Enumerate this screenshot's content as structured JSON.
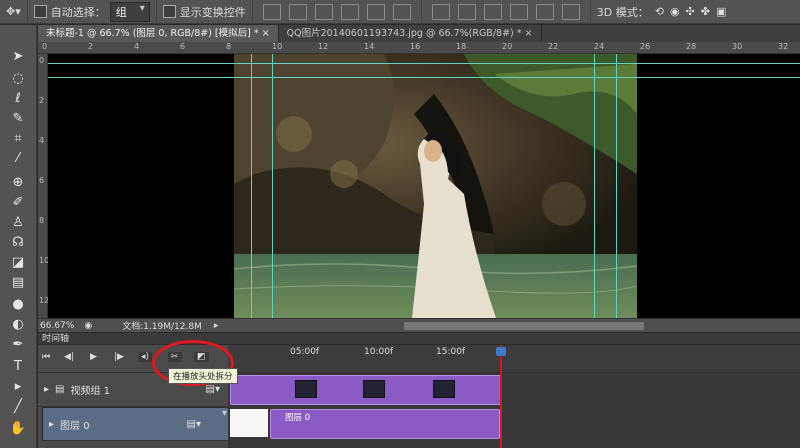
{
  "options_bar": {
    "auto_select_label": "自动选择：",
    "auto_select_value": "组",
    "show_transform_label": "显示变换控件",
    "mode_3d_label": "3D 模式："
  },
  "tabs": [
    {
      "label": "未标题-1 @ 66.7% (图层 0, RGB/8#) [模拟后] *",
      "active": true
    },
    {
      "label": "QQ图片20140601193743.jpg @ 66.7%(RGB/8#) *",
      "active": false
    }
  ],
  "ruler": {
    "h_ticks": [
      "0",
      "2",
      "4",
      "6",
      "8",
      "10",
      "12",
      "14",
      "16",
      "18",
      "20",
      "22",
      "24",
      "26",
      "28",
      "30",
      "32"
    ],
    "v_ticks": [
      "0",
      "2",
      "4",
      "6",
      "8",
      "10",
      "12"
    ]
  },
  "status_bar": {
    "zoom": "66.67%",
    "doc_info": "文档:1.19M/12.8M"
  },
  "timeline": {
    "panel_title": "时间轴",
    "time_labels": [
      "05:00f",
      "10:00f",
      "15:00f"
    ],
    "tooltip": "在播放头处拆分",
    "tracks": [
      {
        "label": "视频组 1",
        "selected": false
      },
      {
        "label": "图层 0",
        "selected": true
      }
    ],
    "clip_label": "图层 0"
  },
  "colors": {
    "guide": "#5fd4c0",
    "clip": "#8a5bc5",
    "playhead": "#d01c1c",
    "highlight_circle": "#e0171e"
  }
}
